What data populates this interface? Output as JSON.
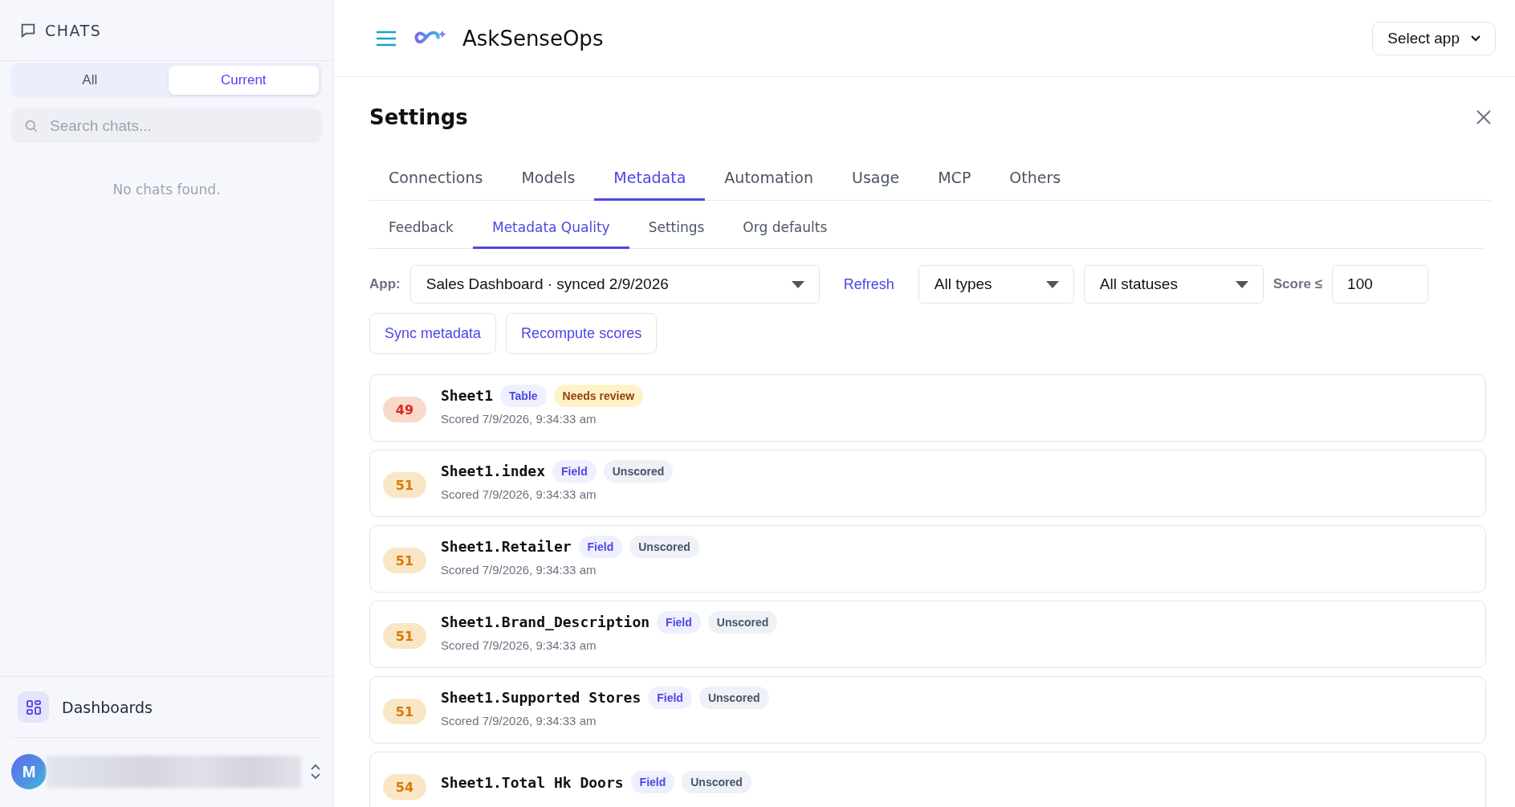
{
  "sidebar": {
    "title": "CHATS",
    "filter_tabs": [
      {
        "label": "All",
        "selected": false
      },
      {
        "label": "Current",
        "selected": true
      }
    ],
    "search": {
      "placeholder": "Search chats..."
    },
    "empty_message": "No chats found.",
    "nav_items": [
      {
        "label": "Dashboards"
      }
    ],
    "user": {
      "initial": "M"
    }
  },
  "header": {
    "app_name": "AskSenseOps",
    "select_app": "Select app"
  },
  "settings": {
    "title": "Settings",
    "tabs": [
      {
        "label": "Connections",
        "selected": false
      },
      {
        "label": "Models",
        "selected": false
      },
      {
        "label": "Metadata",
        "selected": true
      },
      {
        "label": "Automation",
        "selected": false
      },
      {
        "label": "Usage",
        "selected": false
      },
      {
        "label": "MCP",
        "selected": false
      },
      {
        "label": "Others",
        "selected": false
      }
    ],
    "subtabs": [
      {
        "label": "Feedback",
        "selected": false
      },
      {
        "label": "Metadata Quality",
        "selected": true
      },
      {
        "label": "Settings",
        "selected": false
      },
      {
        "label": "Org defaults",
        "selected": false
      }
    ],
    "filters": {
      "app_label": "App:",
      "app_value": "Sales Dashboard · synced 2/9/2026",
      "refresh": "Refresh",
      "type_value": "All types",
      "status_value": "All statuses",
      "score_label": "Score ≤",
      "score_value": "100"
    },
    "actions": [
      "Sync metadata",
      "Recompute scores"
    ],
    "items": [
      {
        "score": "49",
        "color": "#dc2626",
        "name": "Sheet1",
        "type": "Table",
        "status": {
          "label": "Needs review",
          "kind": "review"
        },
        "scored": "Scored 7/9/2026, 9:34:33 am"
      },
      {
        "score": "51",
        "color": "#d97706",
        "name": "Sheet1.index",
        "type": "Field",
        "status": {
          "label": "Unscored",
          "kind": "unscored"
        },
        "scored": "Scored 7/9/2026, 9:34:33 am"
      },
      {
        "score": "51",
        "color": "#d97706",
        "name": "Sheet1.Retailer",
        "type": "Field",
        "status": {
          "label": "Unscored",
          "kind": "unscored"
        },
        "scored": "Scored 7/9/2026, 9:34:33 am"
      },
      {
        "score": "51",
        "color": "#d97706",
        "name": "Sheet1.Brand_Description",
        "type": "Field",
        "status": {
          "label": "Unscored",
          "kind": "unscored"
        },
        "scored": "Scored 7/9/2026, 9:34:33 am"
      },
      {
        "score": "51",
        "color": "#d97706",
        "name": "Sheet1.Supported Stores",
        "type": "Field",
        "status": {
          "label": "Unscored",
          "kind": "unscored"
        },
        "scored": "Scored 7/9/2026, 9:34:33 am"
      },
      {
        "score": "54",
        "color": "#d97706",
        "name": "Sheet1.Total Hk Doors",
        "type": "Field",
        "status": {
          "label": "Unscored",
          "kind": "unscored"
        }
      }
    ]
  }
}
